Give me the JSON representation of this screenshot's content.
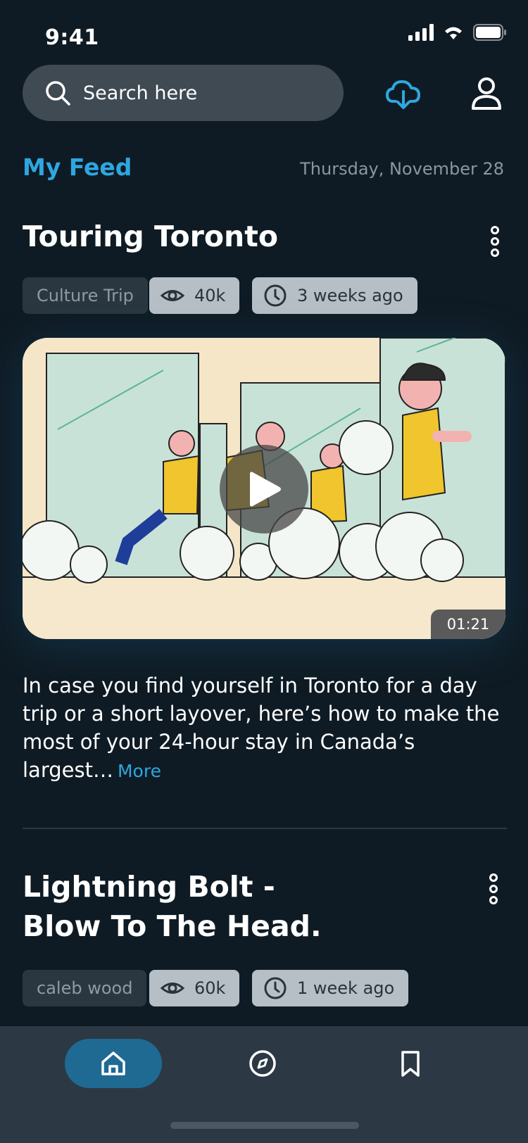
{
  "status_bar": {
    "time": "9:41"
  },
  "search": {
    "placeholder": "Search here"
  },
  "icons": {
    "search": "search-icon",
    "download": "cloud-download-icon",
    "profile": "user-icon",
    "home": "home-icon",
    "explore": "compass-icon",
    "saved": "bookmark-icon"
  },
  "feed": {
    "title": "My Feed",
    "date": "Thursday, November 28"
  },
  "posts": [
    {
      "title": "Touring Toronto",
      "tag": "Culture Trip",
      "views": "40k",
      "time": "3 weeks ago",
      "duration": "01:21",
      "description": "In case you find yourself in Toronto for a day trip or a short layover, here’s how to make the most of your 24-hour stay in Canada’s largest…",
      "more_label": "More"
    },
    {
      "title": "Lightning Bolt - Blow To The Head.",
      "tag": "caleb wood",
      "views": "60k",
      "time": "1 week ago"
    }
  ],
  "colors": {
    "background": "#0f1b24",
    "accent": "#2ea7e0",
    "nav_active": "#1f6a93",
    "nav_bar": "#2c3944"
  }
}
